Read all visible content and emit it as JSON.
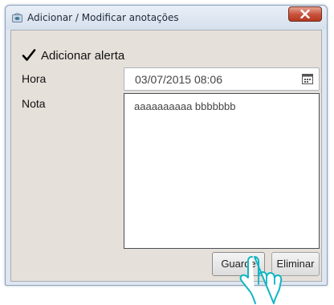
{
  "window": {
    "title": "Adicionar / Modificar anotações"
  },
  "form": {
    "add_alert_label": "Adicionar alerta",
    "add_alert_checked": true,
    "time_label": "Hora",
    "time_value": "03/07/2015 08:06",
    "note_label": "Nota",
    "note_value": "aaaaaaaaaa bbbbbbb"
  },
  "buttons": {
    "save_label": "Guarde",
    "delete_label": "Eliminar"
  },
  "icons": {
    "app": "app-icon",
    "close": "close-icon",
    "checkmark": "checkmark-icon",
    "calendar": "calendar-icon",
    "cursor": "hand-pointer-cursor"
  },
  "colors": {
    "close_button": "#c8513a",
    "dialog_background": "#e6e0da",
    "title_bar": "#dfe6ef"
  }
}
